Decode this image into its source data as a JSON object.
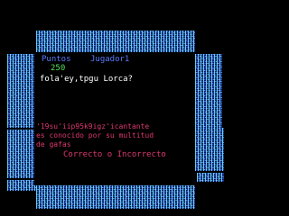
{
  "header": {
    "points_label": "Puntos",
    "player_label": "Jugador1"
  },
  "score": "250",
  "question": "fola'ey,tpgu Lorca?",
  "clue_lines": [
    "'19su'iip95k9igz'icantante",
    "es conocido por su multitud",
    "de gafas"
  ],
  "answer_prompt": "Correcto o Incorrecto",
  "colors": {
    "background": "#000000",
    "header": "#5a7bff",
    "score": "#55e05a",
    "question": "#ffffff",
    "clue": "#e03870",
    "border_noise": "#1e3ea8"
  }
}
